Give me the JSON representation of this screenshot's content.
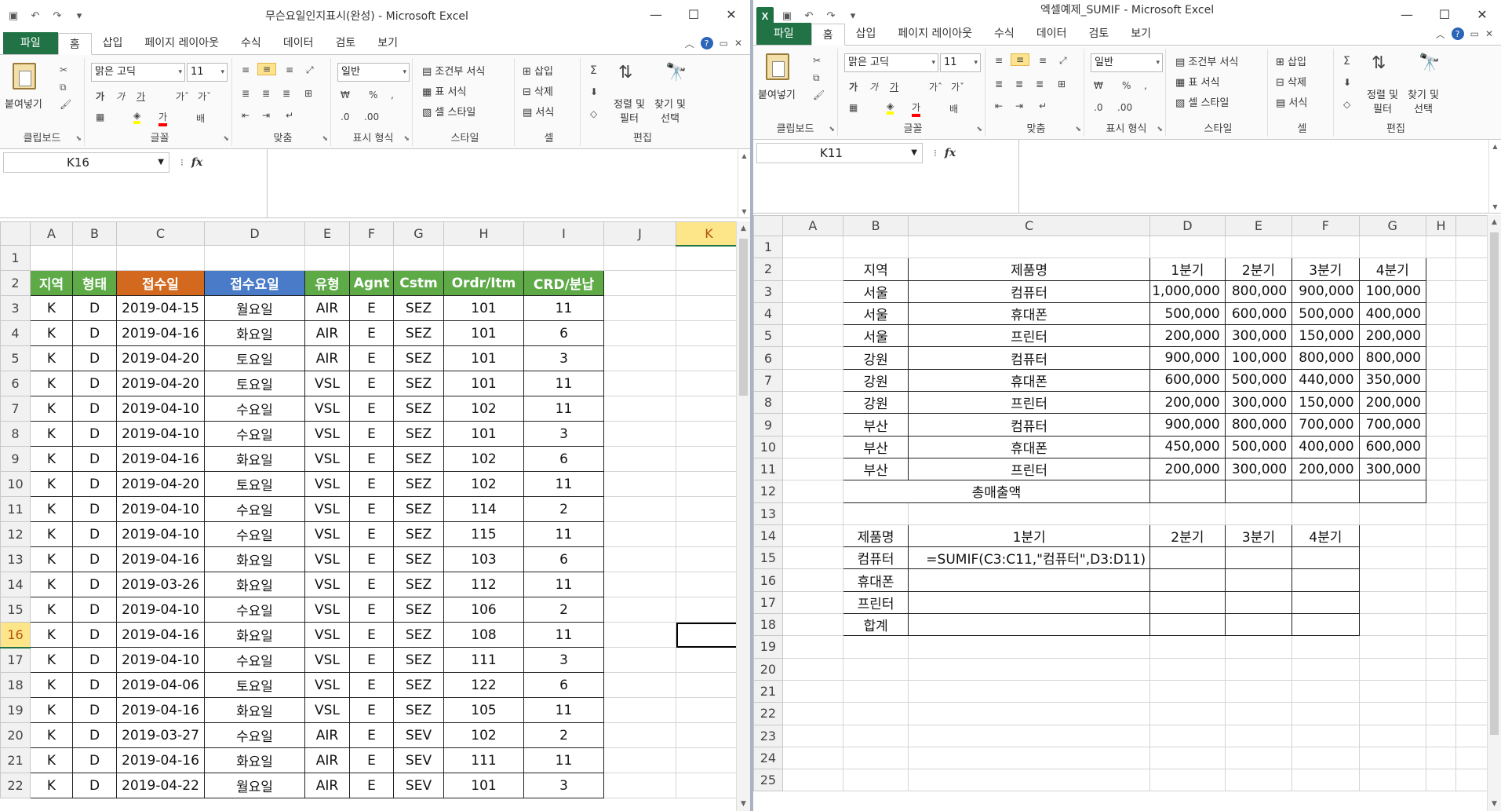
{
  "colors": {
    "excel_green": "#217346",
    "hdr_green": "#5daa47",
    "hdr_orange": "#d2691e",
    "hdr_blue": "#4a7bc8",
    "active_header": "#fde68a"
  },
  "ribbon_tabs": [
    "파일",
    "홈",
    "삽입",
    "페이지 레이아웃",
    "수식",
    "데이터",
    "검토",
    "보기"
  ],
  "ribbon": {
    "paste": "붙여넣기",
    "font_name": "맑은 고딕",
    "font_size": "11",
    "number_format": "일반",
    "cond_format": "조건부 서식",
    "table_format": "표 서식",
    "cell_style": "셀 스타일",
    "insert": "삽입",
    "delete": "삭제",
    "format": "서식",
    "sort_filter": "정렬 및",
    "sort_filter2": "필터",
    "find_select": "찾기 및",
    "find_select2": "선택",
    "sum_icon": "Σ",
    "groups": {
      "clipboard": "클립보드",
      "font": "글꼴",
      "align": "맞춤",
      "number": "표시 형식",
      "style": "스타일",
      "cells": "셀",
      "edit": "편집"
    }
  },
  "left": {
    "title": "무슨요일인지표시(완성)  -  Microsoft Excel",
    "name_box": "K16",
    "columns": [
      "A",
      "B",
      "C",
      "D",
      "E",
      "F",
      "G",
      "H",
      "I",
      "J",
      "K"
    ],
    "active_col": "K",
    "active_row": "16",
    "headers": [
      "지역",
      "형태",
      "접수일",
      "접수요일",
      "유형",
      "Agnt",
      "Cstm",
      "Ordr/Itm",
      "CRD/분납"
    ],
    "rows": [
      [
        "3",
        "K",
        "D",
        "2019-04-15",
        "월요일",
        "AIR",
        "E",
        "SEZ",
        "101",
        "11"
      ],
      [
        "4",
        "K",
        "D",
        "2019-04-16",
        "화요일",
        "AIR",
        "E",
        "SEZ",
        "101",
        "6"
      ],
      [
        "5",
        "K",
        "D",
        "2019-04-20",
        "토요일",
        "AIR",
        "E",
        "SEZ",
        "101",
        "3"
      ],
      [
        "6",
        "K",
        "D",
        "2019-04-20",
        "토요일",
        "VSL",
        "E",
        "SEZ",
        "101",
        "11"
      ],
      [
        "7",
        "K",
        "D",
        "2019-04-10",
        "수요일",
        "VSL",
        "E",
        "SEZ",
        "102",
        "11"
      ],
      [
        "8",
        "K",
        "D",
        "2019-04-10",
        "수요일",
        "VSL",
        "E",
        "SEZ",
        "101",
        "3"
      ],
      [
        "9",
        "K",
        "D",
        "2019-04-16",
        "화요일",
        "VSL",
        "E",
        "SEZ",
        "102",
        "6"
      ],
      [
        "10",
        "K",
        "D",
        "2019-04-20",
        "토요일",
        "VSL",
        "E",
        "SEZ",
        "102",
        "11"
      ],
      [
        "11",
        "K",
        "D",
        "2019-04-10",
        "수요일",
        "VSL",
        "E",
        "SEZ",
        "114",
        "2"
      ],
      [
        "12",
        "K",
        "D",
        "2019-04-10",
        "수요일",
        "VSL",
        "E",
        "SEZ",
        "115",
        "11"
      ],
      [
        "13",
        "K",
        "D",
        "2019-04-16",
        "화요일",
        "VSL",
        "E",
        "SEZ",
        "103",
        "6"
      ],
      [
        "14",
        "K",
        "D",
        "2019-03-26",
        "화요일",
        "VSL",
        "E",
        "SEZ",
        "112",
        "11"
      ],
      [
        "15",
        "K",
        "D",
        "2019-04-10",
        "수요일",
        "VSL",
        "E",
        "SEZ",
        "106",
        "2"
      ],
      [
        "16",
        "K",
        "D",
        "2019-04-16",
        "화요일",
        "VSL",
        "E",
        "SEZ",
        "108",
        "11"
      ],
      [
        "17",
        "K",
        "D",
        "2019-04-10",
        "수요일",
        "VSL",
        "E",
        "SEZ",
        "111",
        "3"
      ],
      [
        "18",
        "K",
        "D",
        "2019-04-06",
        "토요일",
        "VSL",
        "E",
        "SEZ",
        "122",
        "6"
      ],
      [
        "19",
        "K",
        "D",
        "2019-04-16",
        "화요일",
        "VSL",
        "E",
        "SEZ",
        "105",
        "11"
      ],
      [
        "20",
        "K",
        "D",
        "2019-03-27",
        "수요일",
        "AIR",
        "E",
        "SEV",
        "102",
        "2"
      ],
      [
        "21",
        "K",
        "D",
        "2019-04-16",
        "화요일",
        "AIR",
        "E",
        "SEV",
        "111",
        "11"
      ],
      [
        "22",
        "K",
        "D",
        "2019-04-22",
        "월요일",
        "AIR",
        "E",
        "SEV",
        "101",
        "3"
      ]
    ]
  },
  "right": {
    "title": "엑셀예제_SUMIF  -  Microsoft Excel",
    "name_box": "K11",
    "columns": [
      "A",
      "B",
      "C",
      "D",
      "E",
      "F",
      "G",
      "H"
    ],
    "table1_headers": [
      "지역",
      "제품명",
      "1분기",
      "2분기",
      "3분기",
      "4분기"
    ],
    "table1_rows": [
      [
        "서울",
        "컴퓨터",
        "1,000,000",
        "800,000",
        "900,000",
        "100,000"
      ],
      [
        "서울",
        "휴대폰",
        "500,000",
        "600,000",
        "500,000",
        "400,000"
      ],
      [
        "서울",
        "프린터",
        "200,000",
        "300,000",
        "150,000",
        "200,000"
      ],
      [
        "강원",
        "컴퓨터",
        "900,000",
        "100,000",
        "800,000",
        "800,000"
      ],
      [
        "강원",
        "휴대폰",
        "600,000",
        "500,000",
        "440,000",
        "350,000"
      ],
      [
        "강원",
        "프린터",
        "200,000",
        "300,000",
        "150,000",
        "200,000"
      ],
      [
        "부산",
        "컴퓨터",
        "900,000",
        "800,000",
        "700,000",
        "700,000"
      ],
      [
        "부산",
        "휴대폰",
        "450,000",
        "500,000",
        "400,000",
        "600,000"
      ],
      [
        "부산",
        "프린터",
        "200,000",
        "300,000",
        "200,000",
        "300,000"
      ]
    ],
    "total_label": "총매출액",
    "table2_headers": [
      "제품명",
      "1분기",
      "2분기",
      "3분기",
      "4분기"
    ],
    "table2_rows": [
      "컴퓨터",
      "휴대폰",
      "프린터",
      "합계"
    ],
    "formula": "=SUMIF(C3:C11,\"컴퓨터\",D3:D11)"
  }
}
